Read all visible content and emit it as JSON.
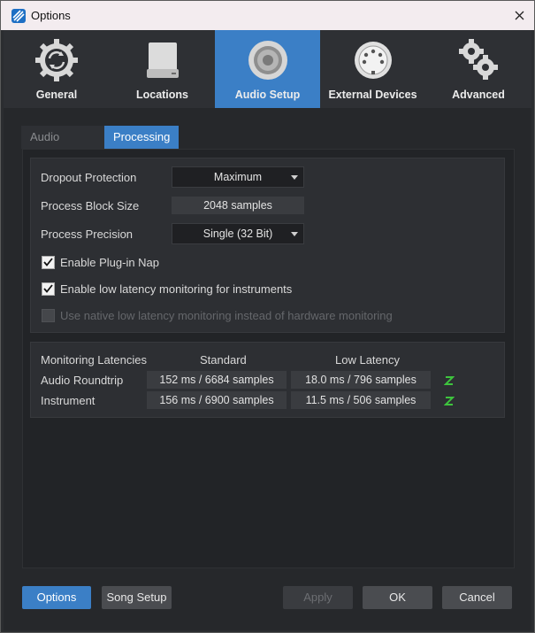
{
  "window": {
    "title": "Options",
    "close_glyph": "✕"
  },
  "header_tabs": [
    {
      "label": "General",
      "icon": "gear-cycle-icon",
      "active": false
    },
    {
      "label": "Locations",
      "icon": "drive-icon",
      "active": false
    },
    {
      "label": "Audio Setup",
      "icon": "speaker-icon",
      "active": true
    },
    {
      "label": "External Devices",
      "icon": "midi-connector-icon",
      "active": false
    },
    {
      "label": "Advanced",
      "icon": "gears-icon",
      "active": false
    }
  ],
  "sub_tabs": [
    {
      "label": "Audio Device",
      "active": false
    },
    {
      "label": "Processing",
      "active": true
    }
  ],
  "processing": {
    "dropout_protection": {
      "label": "Dropout Protection",
      "value": "Maximum"
    },
    "block_size": {
      "label": "Process Block Size",
      "value": "2048 samples"
    },
    "precision": {
      "label": "Process Precision",
      "value": "Single (32 Bit)"
    },
    "plugin_nap": {
      "label": "Enable Plug-in Nap",
      "checked": true
    },
    "low_latency": {
      "label": "Enable low latency monitoring for instruments",
      "checked": true
    },
    "native_low_latency": {
      "label": "Use native low latency monitoring instead of hardware monitoring",
      "checked": false,
      "disabled": true
    }
  },
  "latencies": {
    "header": "Monitoring Latencies",
    "col_standard": "Standard",
    "col_low": "Low Latency",
    "rows": [
      {
        "label": "Audio Roundtrip",
        "standard": "152 ms / 6684 samples",
        "low": "18.0 ms / 796 samples",
        "icon": "z-icon"
      },
      {
        "label": "Instrument",
        "standard": "156 ms / 6900 samples",
        "low": "11.5 ms / 506 samples",
        "icon": "z-icon"
      }
    ],
    "z_color": "#3ec43e"
  },
  "buttons": {
    "options": "Options",
    "song_setup": "Song Setup",
    "apply": "Apply",
    "ok": "OK",
    "cancel": "Cancel"
  },
  "colors": {
    "accent": "#3b7fc6"
  }
}
